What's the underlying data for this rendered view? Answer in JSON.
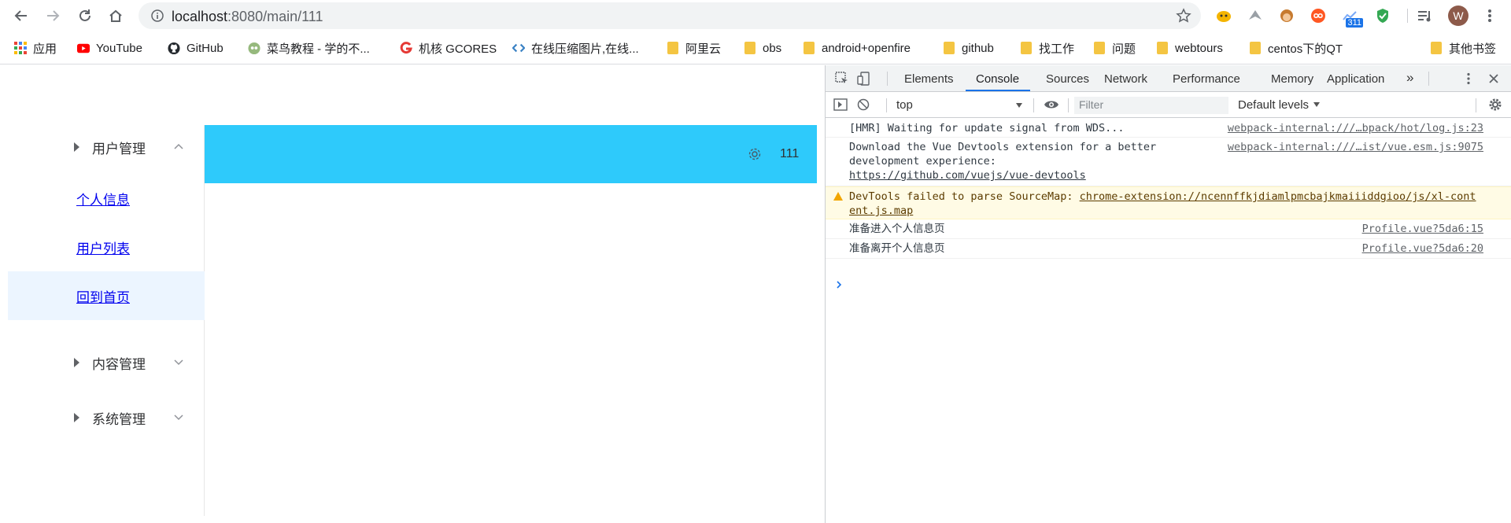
{
  "browser": {
    "url_host": "localhost",
    "url_rest": ":8080/main/111",
    "avatar_letter": "W",
    "ext_badge": "311",
    "colors": {
      "toolbar_bg": "#ffffff",
      "omnibox_bg": "#f1f3f4",
      "accent": "#1a73e8"
    }
  },
  "bookmarks": [
    {
      "label": "应用",
      "icon": "apps-grid-icon"
    },
    {
      "label": "YouTube",
      "icon": "youtube-icon"
    },
    {
      "label": "GitHub",
      "icon": "github-icon"
    },
    {
      "label": "菜鸟教程 - 学的不...",
      "icon": "runoob-icon"
    },
    {
      "label": "机核 GCORES",
      "icon": "gcores-icon"
    },
    {
      "label": "在线压缩图片,在线...",
      "icon": "compress-icon"
    },
    {
      "label": "阿里云",
      "icon": "folder-icon"
    },
    {
      "label": "obs",
      "icon": "folder-icon"
    },
    {
      "label": "android+openfire",
      "icon": "folder-icon"
    },
    {
      "label": "github",
      "icon": "folder-icon"
    },
    {
      "label": "找工作",
      "icon": "folder-icon"
    },
    {
      "label": "问题",
      "icon": "folder-icon"
    },
    {
      "label": "webtours",
      "icon": "folder-icon"
    },
    {
      "label": "centos下的QT",
      "icon": "folder-icon"
    },
    {
      "label": "其他书签",
      "icon": "folder-icon"
    }
  ],
  "sidebar": {
    "menu1": {
      "label": "用户管理",
      "expanded": true
    },
    "items": [
      {
        "label": "个人信息",
        "active": false
      },
      {
        "label": "用户列表",
        "active": false
      },
      {
        "label": "回到首页",
        "active": true
      }
    ],
    "menu2": {
      "label": "内容管理"
    },
    "menu3": {
      "label": "系统管理"
    }
  },
  "header": {
    "username": "111",
    "bg_color": "#2ecafb"
  },
  "devtools": {
    "tabs": [
      "Elements",
      "Console",
      "Sources",
      "Network",
      "Performance",
      "Memory",
      "Application"
    ],
    "active_tab": "Console",
    "more_tabs": "»",
    "context": "top",
    "filter_placeholder": "Filter",
    "levels": "Default levels",
    "logs": [
      {
        "msg": "[HMR] Waiting for update signal from WDS...",
        "src": "webpack-internal:///…bpack/hot/log.js:23"
      },
      {
        "msg_l1": "Download the Vue Devtools extension for a better",
        "msg_l2": "development experience:",
        "link": "https://github.com/vuejs/vue-devtools",
        "src": "webpack-internal:///…ist/vue.esm.js:9075"
      },
      {
        "level": "warning",
        "msg": "DevTools failed to parse SourceMap: ",
        "link_l1": "chrome-extension://ncennffkjdiamlpmcbajkmaiiiddgioo/js/xl-cont",
        "link_l2": "ent.js.map"
      },
      {
        "msg": "准备进入个人信息页",
        "src": "Profile.vue?5da6:15"
      },
      {
        "msg": "准备离开个人信息页",
        "src": "Profile.vue?5da6:20"
      }
    ],
    "prompt": "›"
  }
}
